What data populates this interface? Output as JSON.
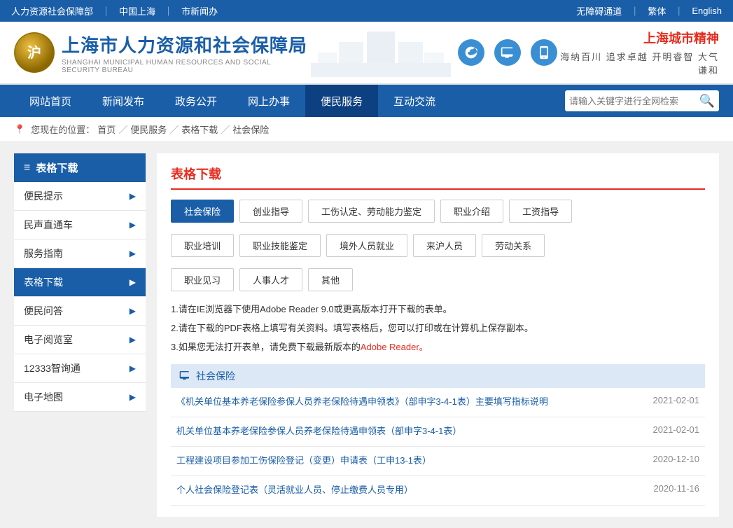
{
  "topbar": {
    "links": [
      "人力资源社会保障部",
      "中国上海",
      "市新闻办"
    ],
    "right_links": [
      "无障碍通道",
      "繁体",
      "English"
    ]
  },
  "header": {
    "logo_icon": "沪",
    "logo_cn": "上海市人力资源和社会保障局",
    "logo_en": "SHANGHAI MUNICIPAL HUMAN RESOURCES AND SOCIAL SECURITY BUREAU",
    "city_spirit_title": "上海城市精神",
    "city_spirit_sub": "海纳百川 追求卓越 开明睿智 大气谦和",
    "social_icons": [
      "微博",
      "微信",
      "手机"
    ]
  },
  "nav": {
    "items": [
      {
        "label": "网站首页",
        "active": false
      },
      {
        "label": "新闻发布",
        "active": false
      },
      {
        "label": "政务公开",
        "active": false
      },
      {
        "label": "网上办事",
        "active": false
      },
      {
        "label": "便民服务",
        "active": true
      },
      {
        "label": "互动交流",
        "active": false
      }
    ],
    "search_placeholder": "请输入关键字进行全网检索"
  },
  "breadcrumb": {
    "label": "您现在的位置：",
    "items": [
      "首页",
      "便民服务",
      "表格下载",
      "社会保险"
    ],
    "separators": [
      "／",
      "／",
      "／"
    ]
  },
  "sidebar": {
    "title": "表格下载",
    "items": [
      {
        "label": "便民提示",
        "active": false
      },
      {
        "label": "民声直通车",
        "active": false
      },
      {
        "label": "服务指南",
        "active": false
      },
      {
        "label": "表格下载",
        "active": true
      },
      {
        "label": "便民问答",
        "active": false
      },
      {
        "label": "电子阅览室",
        "active": false
      },
      {
        "label": "12333智询通",
        "active": false
      },
      {
        "label": "电子地图",
        "active": false
      }
    ]
  },
  "content": {
    "title": "表格下载",
    "categories_row1": [
      {
        "label": "社会保险",
        "active": true
      },
      {
        "label": "创业指导",
        "active": false
      },
      {
        "label": "工伤认定、劳动能力鉴定",
        "active": false
      },
      {
        "label": "职业介绍",
        "active": false
      },
      {
        "label": "工资指导",
        "active": false
      }
    ],
    "categories_row2": [
      {
        "label": "职业培训",
        "active": false
      },
      {
        "label": "职业技能鉴定",
        "active": false
      },
      {
        "label": "境外人员就业",
        "active": false
      },
      {
        "label": "来沪人员",
        "active": false
      },
      {
        "label": "劳动关系",
        "active": false
      }
    ],
    "categories_row3": [
      {
        "label": "职业见习",
        "active": false
      },
      {
        "label": "人事人才",
        "active": false
      },
      {
        "label": "其他",
        "active": false
      }
    ],
    "instructions": [
      "1.请在IE浏览器下使用Adobe Reader 9.0或更高版本打开下载的表单。",
      "2.请在下载的PDF表格上填写有关资料。填写表格后，您可以打印或在计算机上保存副本。",
      "3.如果您无法打开表单，请免费下载最新版本的Adobe Reader。"
    ],
    "instruction3_link_text": "Adobe Reader。",
    "section_title": "社会保险",
    "files": [
      {
        "name": "《机关单位基本养老保险参保人员养老保险待遇申领表》（部申字3-4-1表）主要填写指标说明",
        "date": "2021-02-01"
      },
      {
        "name": "机关单位基本养老保险参保人员养老保险待遇申领表（部申字3-4-1表）",
        "date": "2021-02-01"
      },
      {
        "name": "工程建设项目参加工伤保险登记（变更）申请表（工申13-1表）",
        "date": "2020-12-10"
      },
      {
        "name": "个人社会保险登记表（灵活就业人员、停止缴费人员专用）",
        "date": "2020-11-16"
      }
    ]
  }
}
